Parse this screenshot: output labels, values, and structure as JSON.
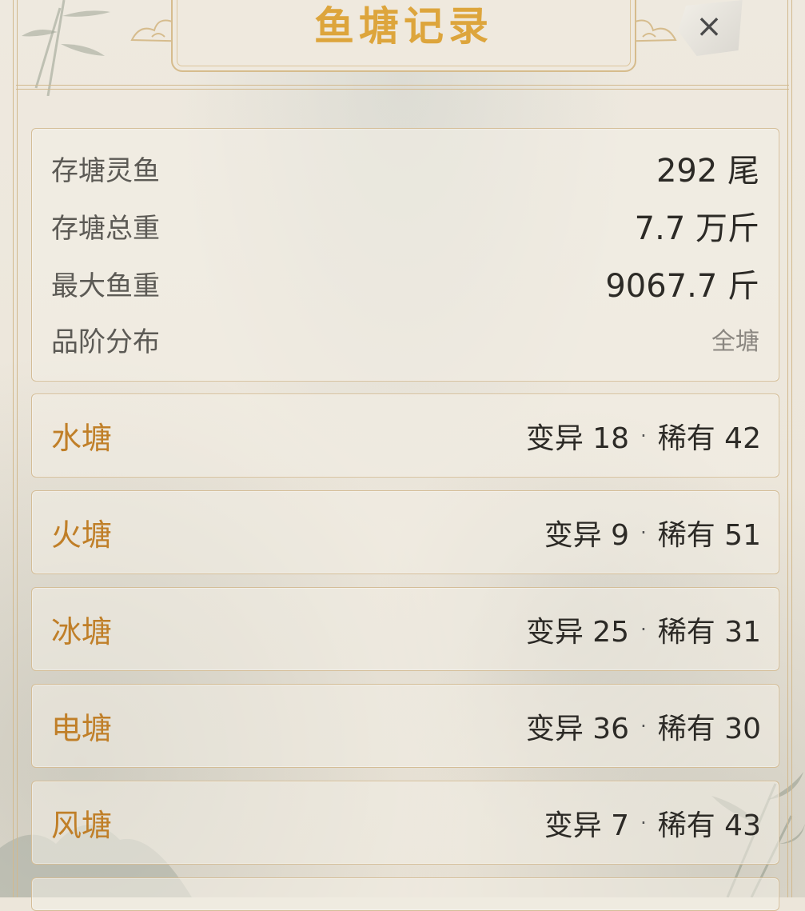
{
  "header": {
    "title": "鱼塘记录",
    "close_label": "×"
  },
  "summary": {
    "fish_count_label": "存塘灵鱼",
    "fish_count_value": "292 尾",
    "total_weight_label": "存塘总重",
    "total_weight_value": "7.7 万斤",
    "max_weight_label": "最大鱼重",
    "max_weight_value": "9067.7 斤",
    "grade_label": "品阶分布",
    "grade_value": "全塘"
  },
  "ponds": [
    {
      "name": "水塘",
      "mutation": "变异 18",
      "rare": "稀有 42"
    },
    {
      "name": "火塘",
      "mutation": "变异 9",
      "rare": "稀有 51"
    },
    {
      "name": "冰塘",
      "mutation": "变异 25",
      "rare": "稀有 31"
    },
    {
      "name": "电塘",
      "mutation": "变异 36",
      "rare": "稀有 30"
    },
    {
      "name": "风塘",
      "mutation": "变异 7",
      "rare": "稀有 43"
    }
  ],
  "separator": "·",
  "colors": {
    "title": "#dda53c",
    "pond_name": "#c07f28",
    "border": "#d4bd97",
    "background": "#ece6da"
  }
}
